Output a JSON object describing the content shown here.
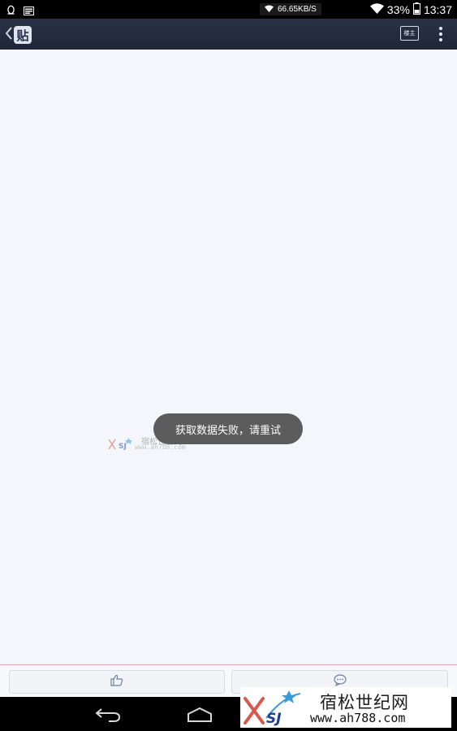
{
  "status_bar": {
    "net_speed": "66.65KB/S",
    "battery": "33%",
    "time": "13:37",
    "icons": [
      "qq-icon",
      "notification-icon",
      "wifi-icon",
      "battery-icon"
    ]
  },
  "title_bar": {
    "back_badge": "贴",
    "louzhu_label": "楼主"
  },
  "toast": {
    "message": "获取数据失败，请重试"
  },
  "watermark": {
    "name": "宿松世纪网",
    "url": "www.ah788.com",
    "logo_text": "SJ"
  },
  "bottom_actions": [
    {
      "icon": "thumbs-up-icon"
    },
    {
      "icon": "comment-icon"
    }
  ],
  "colors": {
    "title_bar": "#1e2637",
    "content_bg": "#f5f6fc",
    "toast_bg": "#5c5c5c"
  }
}
